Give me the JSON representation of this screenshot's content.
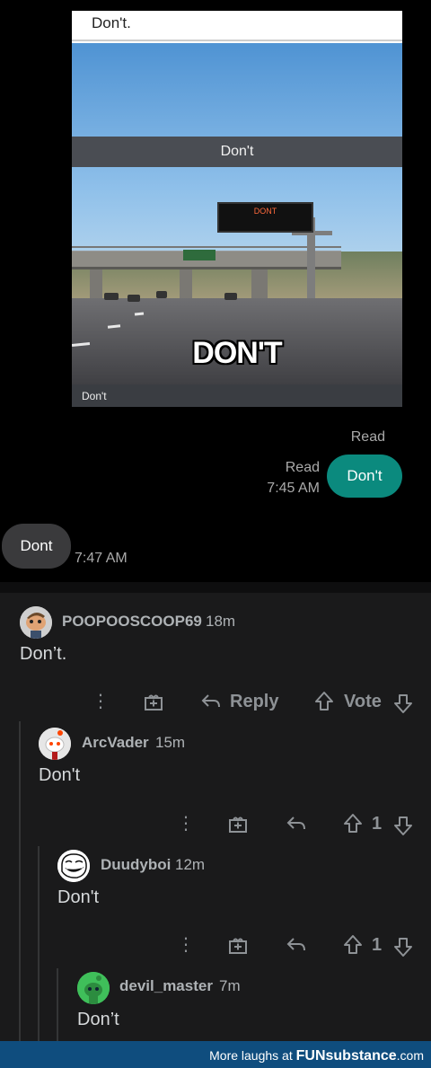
{
  "meme": {
    "top_caption": "Don't.",
    "band_caption": "Don't",
    "billboard_text": "DONT",
    "overlay_text": "DON'T",
    "footer_caption": "Don't"
  },
  "chat": {
    "read_top": "Read",
    "read_second": "Read",
    "sent_time": "7:45 AM",
    "outgoing_message": "Don't",
    "incoming_message": "Dont",
    "incoming_time": "7:47 AM",
    "colors": {
      "outgoing_bubble": "#0b8a7e",
      "incoming_bubble": "#3a3a3c"
    }
  },
  "comments": [
    {
      "username": "POOPOOSCOOP69",
      "age": "18m",
      "body": "Don’t.",
      "reply_label": "Reply",
      "vote_label": "Vote",
      "avatar": "snoo-avatar"
    },
    {
      "username": "ArcVader",
      "age": "15m",
      "body": "Don't",
      "score": "1",
      "avatar": "snoo-avatar"
    },
    {
      "username": "Duudyboi",
      "age": "12m",
      "body": "Don't",
      "score": "1",
      "avatar": "trollface-avatar"
    },
    {
      "username": "devil_master",
      "age": "7m",
      "body": "Don’t",
      "avatar": "green-snoo-avatar"
    }
  ],
  "banner": {
    "prefix": "More laughs at",
    "brand": "FUNsubstance",
    "suffix": ".com"
  }
}
